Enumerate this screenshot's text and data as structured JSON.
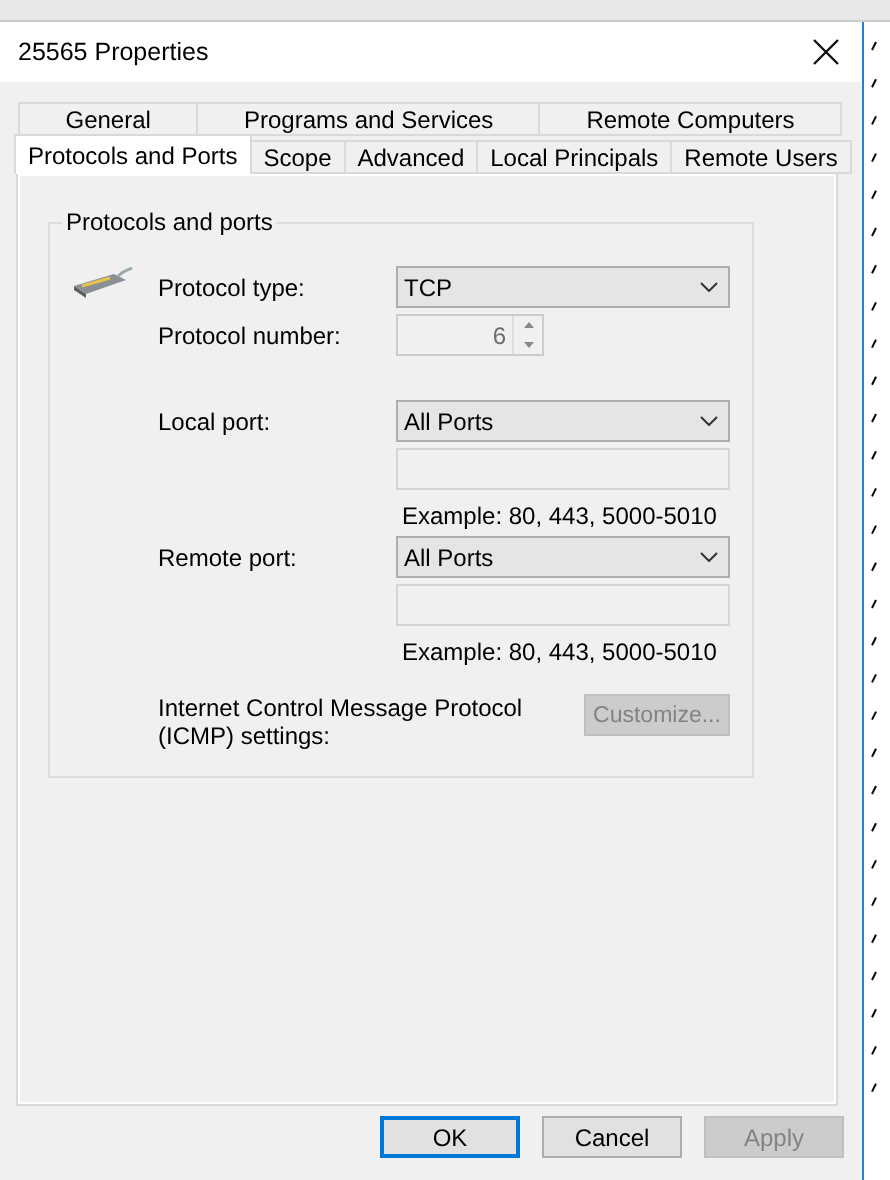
{
  "window": {
    "title": "25565 Properties"
  },
  "tab_rows": [
    [
      {
        "label": "General",
        "selected": false
      },
      {
        "label": "Programs and Services",
        "selected": false
      },
      {
        "label": "Remote Computers",
        "selected": false
      }
    ],
    [
      {
        "label": "Protocols and Ports",
        "selected": true
      },
      {
        "label": "Scope",
        "selected": false
      },
      {
        "label": "Advanced",
        "selected": false
      },
      {
        "label": "Local Principals",
        "selected": false
      },
      {
        "label": "Remote Users",
        "selected": false
      }
    ]
  ],
  "group": {
    "title": "Protocols and ports",
    "rows": [
      {
        "kind": "combo",
        "label": "Protocol type:",
        "value": "TCP"
      },
      {
        "kind": "spin",
        "label": "Protocol number:",
        "value": "6",
        "disabled": true
      },
      {
        "kind": "combo",
        "label": "Local port:",
        "value": "All Ports"
      },
      {
        "kind": "text"
      },
      {
        "kind": "hint",
        "text": "Example: 80, 443, 5000-5010"
      },
      {
        "kind": "combo",
        "label": "Remote port:",
        "value": "All Ports"
      },
      {
        "kind": "text"
      },
      {
        "kind": "hint",
        "text": "Example: 80, 443, 5000-5010"
      },
      {
        "kind": "button",
        "label": "Internet Control Message Protocol (ICMP) settings:",
        "button": "Customize...",
        "disabled": true
      }
    ]
  },
  "buttons": [
    {
      "label": "OK",
      "default": true,
      "disabled": false
    },
    {
      "label": "Cancel",
      "default": false,
      "disabled": false
    },
    {
      "label": "Apply",
      "default": false,
      "disabled": true
    }
  ]
}
